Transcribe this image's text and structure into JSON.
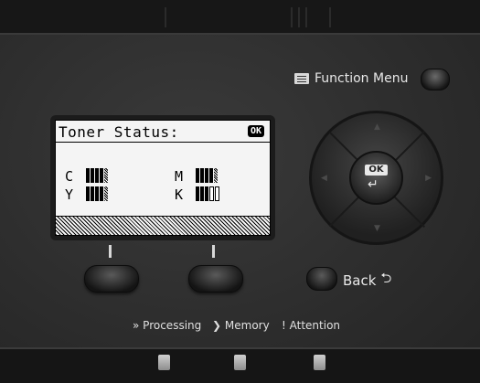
{
  "lcd": {
    "title": "Toner Status:",
    "ok_badge": "OK",
    "toners": [
      {
        "channel": "C",
        "level": 0.8
      },
      {
        "channel": "M",
        "level": 0.8
      },
      {
        "channel": "Y",
        "level": 0.8
      },
      {
        "channel": "K",
        "level": 0.6
      }
    ]
  },
  "controls": {
    "function_menu_label": "Function Menu",
    "ok_label": "OK",
    "ok_enter_symbol": "↵",
    "back_label": "Back",
    "back_symbol": "⮌",
    "soft_key_symbol": "|"
  },
  "indicators": {
    "processing": "Processing",
    "processing_symbol": "»",
    "memory": "Memory",
    "memory_symbol": "❯",
    "attention": "Attention",
    "attention_symbol": "!"
  },
  "colors": {
    "panel": "#2d2d2d",
    "lcd_background": "#f4f4f4",
    "label_text": "#e8e8e8"
  }
}
